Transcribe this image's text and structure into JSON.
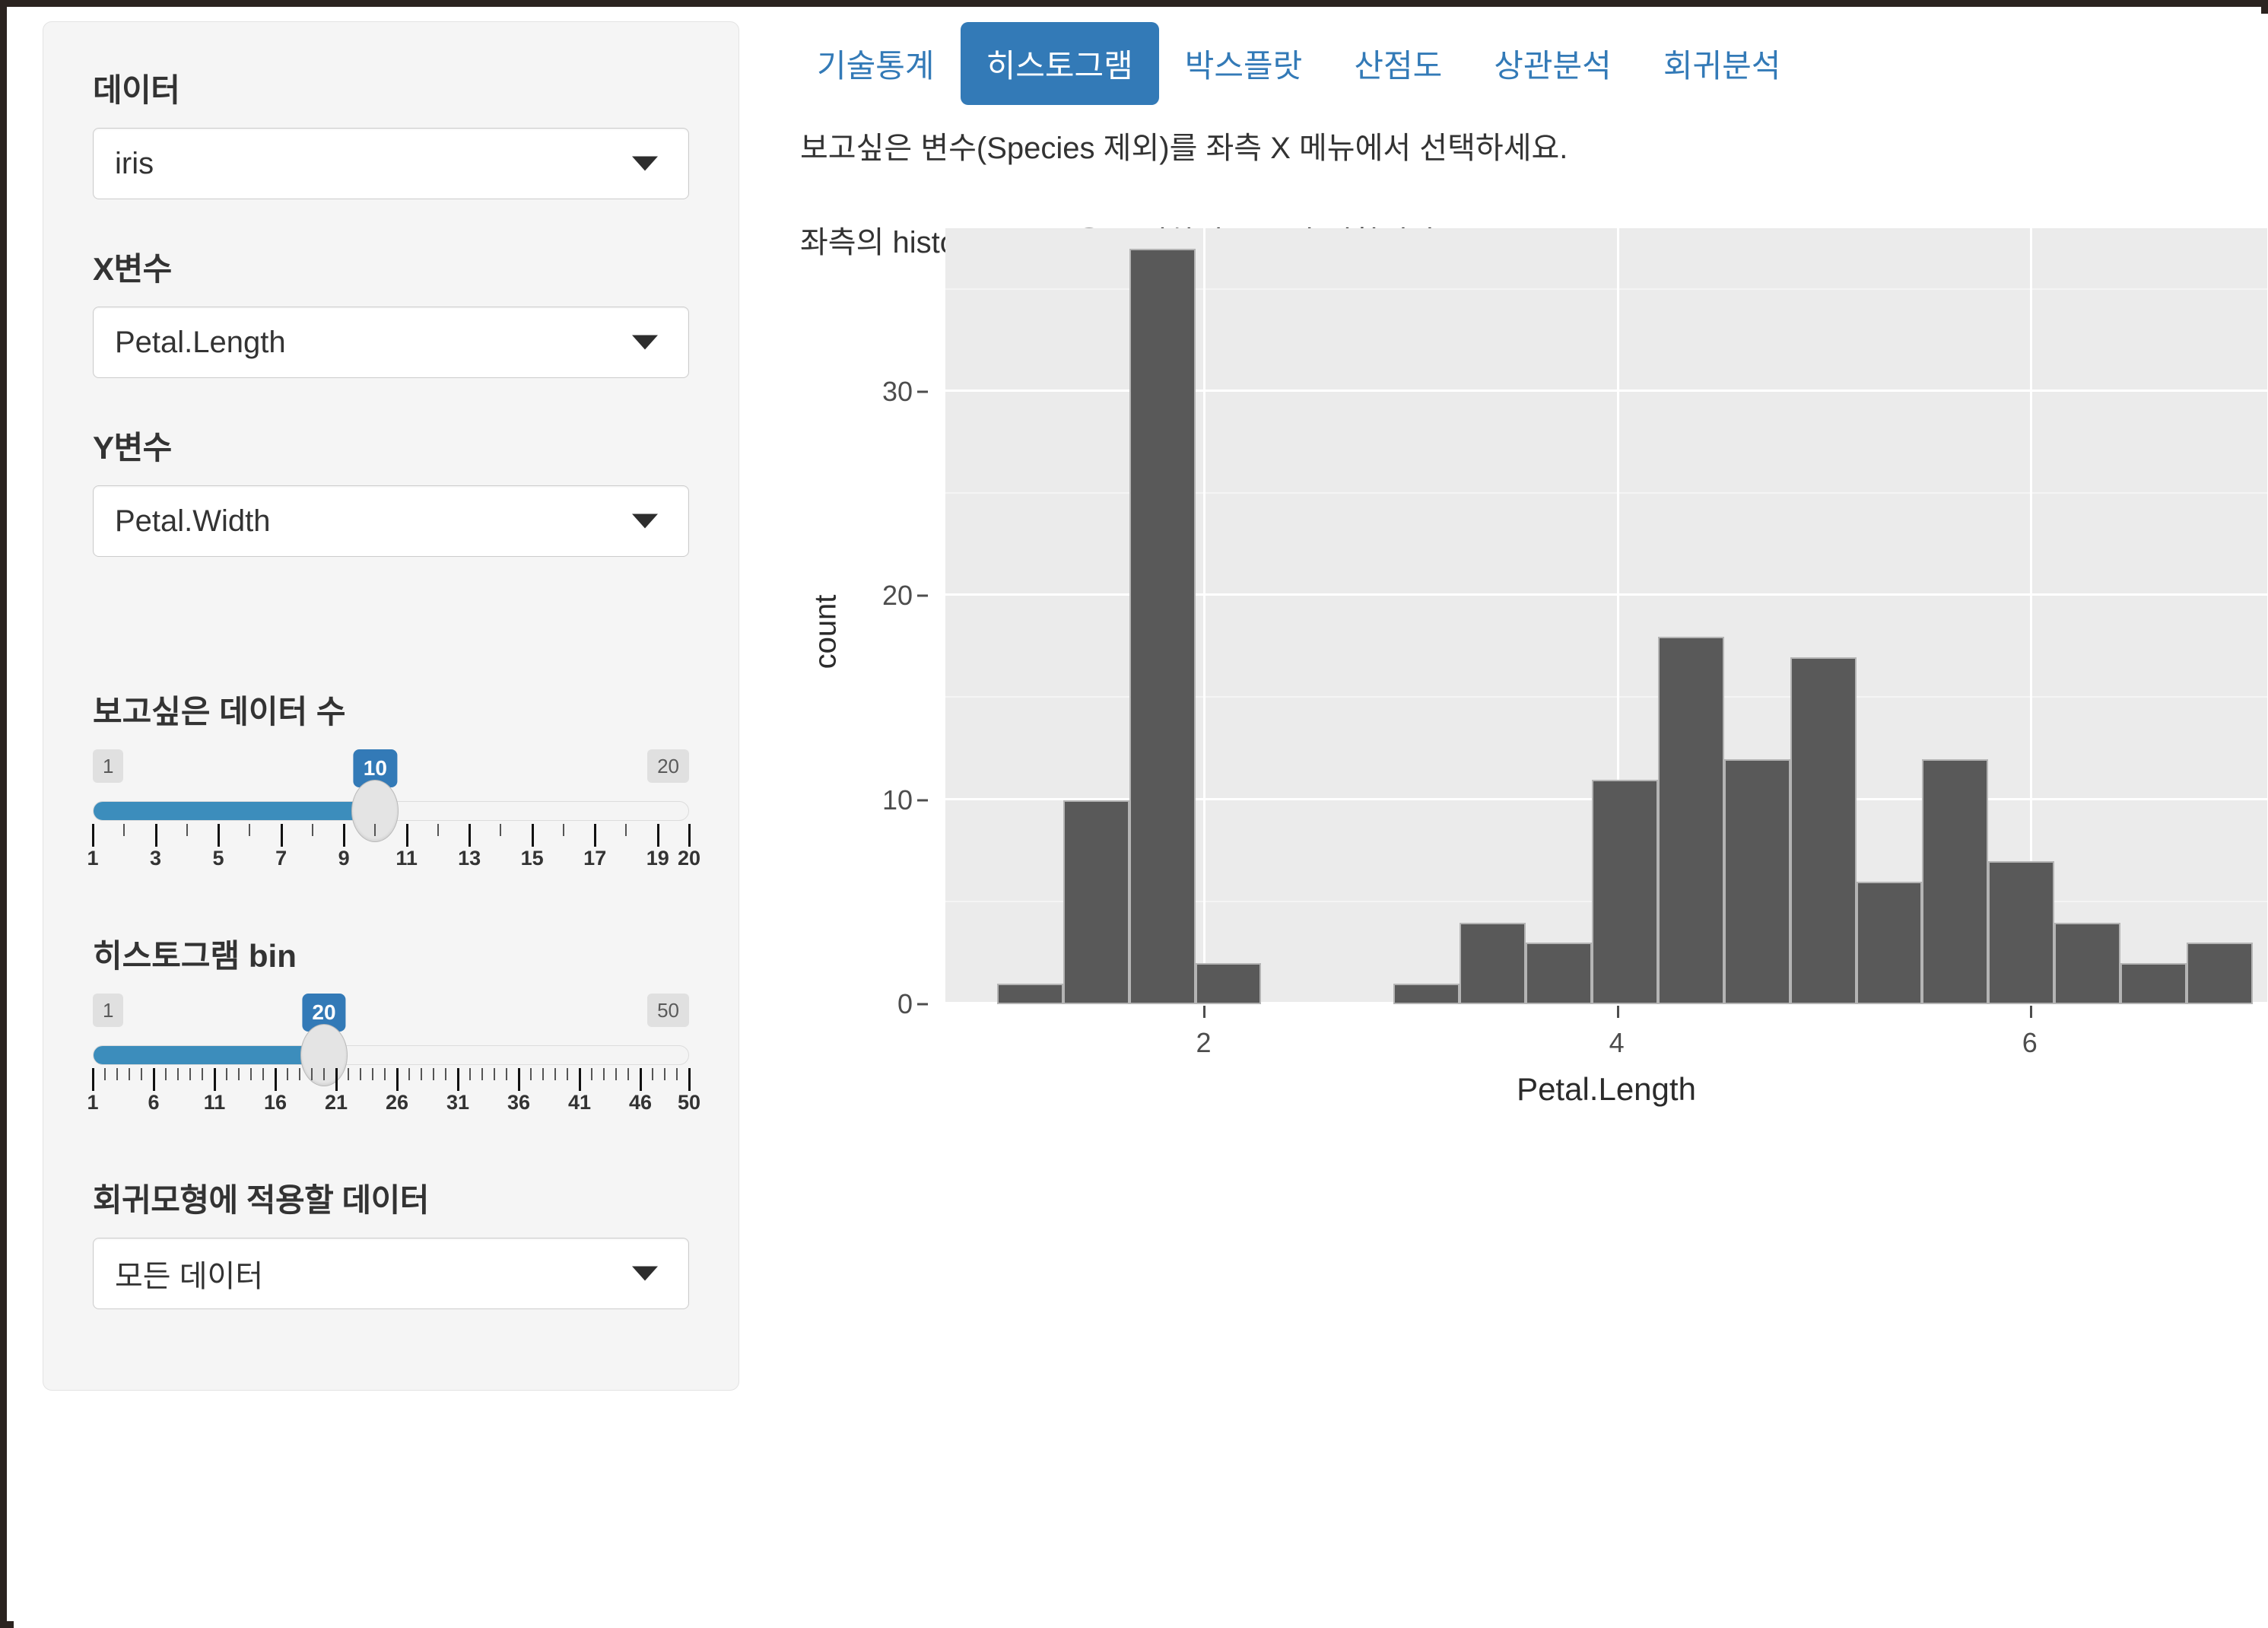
{
  "sidebar": {
    "fields": [
      {
        "label": "데이터",
        "value": "iris",
        "name": "dataset-select"
      },
      {
        "label": "X변수",
        "value": "Petal.Length",
        "name": "x-variable-select"
      },
      {
        "label": "Y변수",
        "value": "Petal.Width",
        "name": "y-variable-select"
      }
    ],
    "sliders": [
      {
        "label": "보고싶은 데이터 수",
        "min": 1,
        "max": 20,
        "value": 10,
        "min_label": "1",
        "max_label": "20",
        "value_label": "10",
        "tick_labels": [
          "1",
          "3",
          "5",
          "7",
          "9",
          "11",
          "13",
          "15",
          "17",
          "19",
          "20"
        ],
        "tick_values": [
          1,
          3,
          5,
          7,
          9,
          11,
          13,
          15,
          17,
          19,
          20
        ]
      },
      {
        "label": "히스토그램 bin",
        "min": 1,
        "max": 50,
        "value": 20,
        "min_label": "1",
        "max_label": "50",
        "value_label": "20",
        "tick_labels": [
          "1",
          "6",
          "11",
          "16",
          "21",
          "26",
          "31",
          "36",
          "41",
          "46",
          "50"
        ],
        "tick_values": [
          1,
          6,
          11,
          16,
          21,
          26,
          31,
          36,
          41,
          46,
          50
        ]
      }
    ],
    "regression_field": {
      "label": "회귀모형에 적용할 데이터",
      "value": "모든 데이터",
      "name": "regression-data-select"
    }
  },
  "tabs": [
    {
      "label": "기술통계",
      "active": false
    },
    {
      "label": "히스토그램",
      "active": true
    },
    {
      "label": "박스플랏",
      "active": false
    },
    {
      "label": "산점도",
      "active": false
    },
    {
      "label": "상관분석",
      "active": false
    },
    {
      "label": "회귀분석",
      "active": false
    }
  ],
  "main": {
    "help_line1": "보고싶은 변수(Species 제외)를 좌측 X 메뉴에서 선택하세요.",
    "help_line2": "좌측의 histogram bin을 조절하면 분포가 변합니다."
  },
  "colors": {
    "accent": "#337ab7",
    "slider_fill": "#3c8dbc",
    "bar_fill": "#595959",
    "panel_bg": "#ebebeb",
    "sidebar_bg": "#f5f5f5"
  },
  "chart_data": {
    "type": "bar",
    "title": "",
    "xlabel": "Petal.Length",
    "ylabel": "count",
    "xlim": [
      0.75,
      7.15
    ],
    "ylim": [
      0,
      38
    ],
    "grid": true,
    "legend": "none",
    "xticks": [
      2,
      4,
      6
    ],
    "yticks": [
      0,
      10,
      20,
      30
    ],
    "bin_width": 0.32,
    "bin_starts": [
      1.0,
      1.32,
      1.64,
      1.96,
      2.28,
      2.6,
      2.92,
      3.24,
      3.56,
      3.88,
      4.2,
      4.52,
      4.84,
      5.16,
      5.48,
      5.8,
      6.12,
      6.44,
      6.76
    ],
    "bin_centers": [
      1.16,
      1.48,
      1.8,
      2.12,
      2.44,
      2.76,
      3.08,
      3.4,
      3.72,
      4.04,
      4.36,
      4.68,
      5.0,
      5.32,
      5.64,
      5.96,
      6.28,
      6.6,
      6.92
    ],
    "values": [
      1,
      10,
      37,
      2,
      0,
      0,
      1,
      4,
      3,
      11,
      18,
      12,
      17,
      6,
      12,
      7,
      4,
      2,
      3
    ]
  }
}
